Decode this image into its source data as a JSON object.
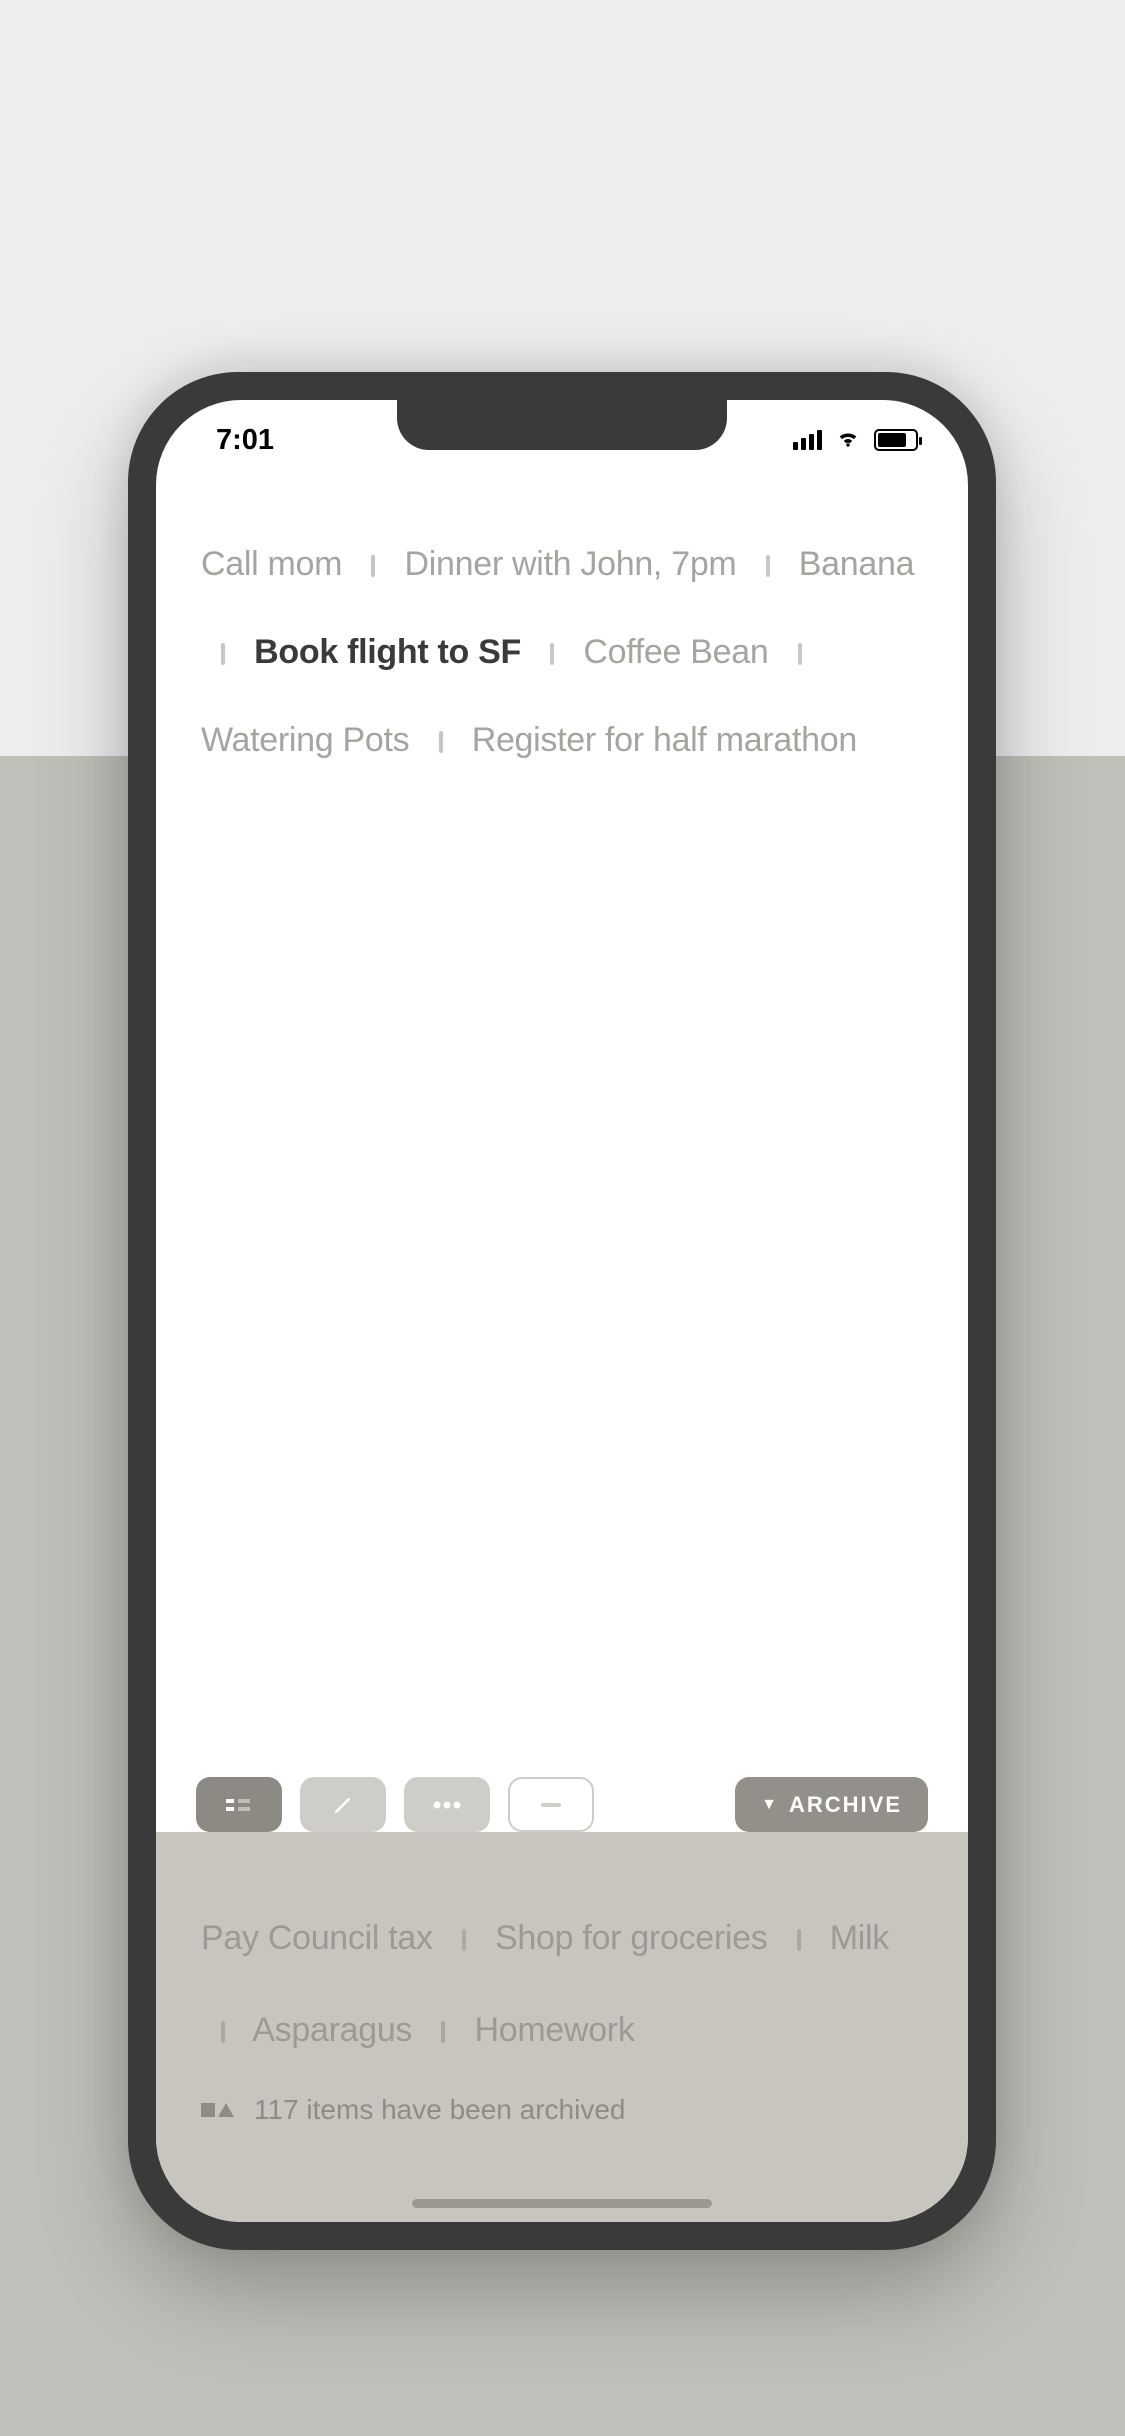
{
  "status": {
    "time": "7:01"
  },
  "tasks": {
    "items": [
      {
        "label": "Call mom",
        "active": false
      },
      {
        "label": "Dinner with John, 7pm",
        "active": false
      },
      {
        "label": "Banana",
        "active": false
      },
      {
        "label": "Book flight to SF",
        "active": true
      },
      {
        "label": "Coffee Bean",
        "active": false
      },
      {
        "label": "Watering Pots",
        "active": false
      },
      {
        "label": "Register for half marathon",
        "active": false
      }
    ]
  },
  "toolbar": {
    "archive_label": "ARCHIVE",
    "archive_caret": "▼"
  },
  "archived": {
    "items": [
      {
        "label": "Pay Council tax"
      },
      {
        "label": "Shop for groceries"
      },
      {
        "label": "Milk"
      },
      {
        "label": "Asparagus"
      },
      {
        "label": "Homework"
      }
    ],
    "status_text": "117 items have been archived"
  }
}
